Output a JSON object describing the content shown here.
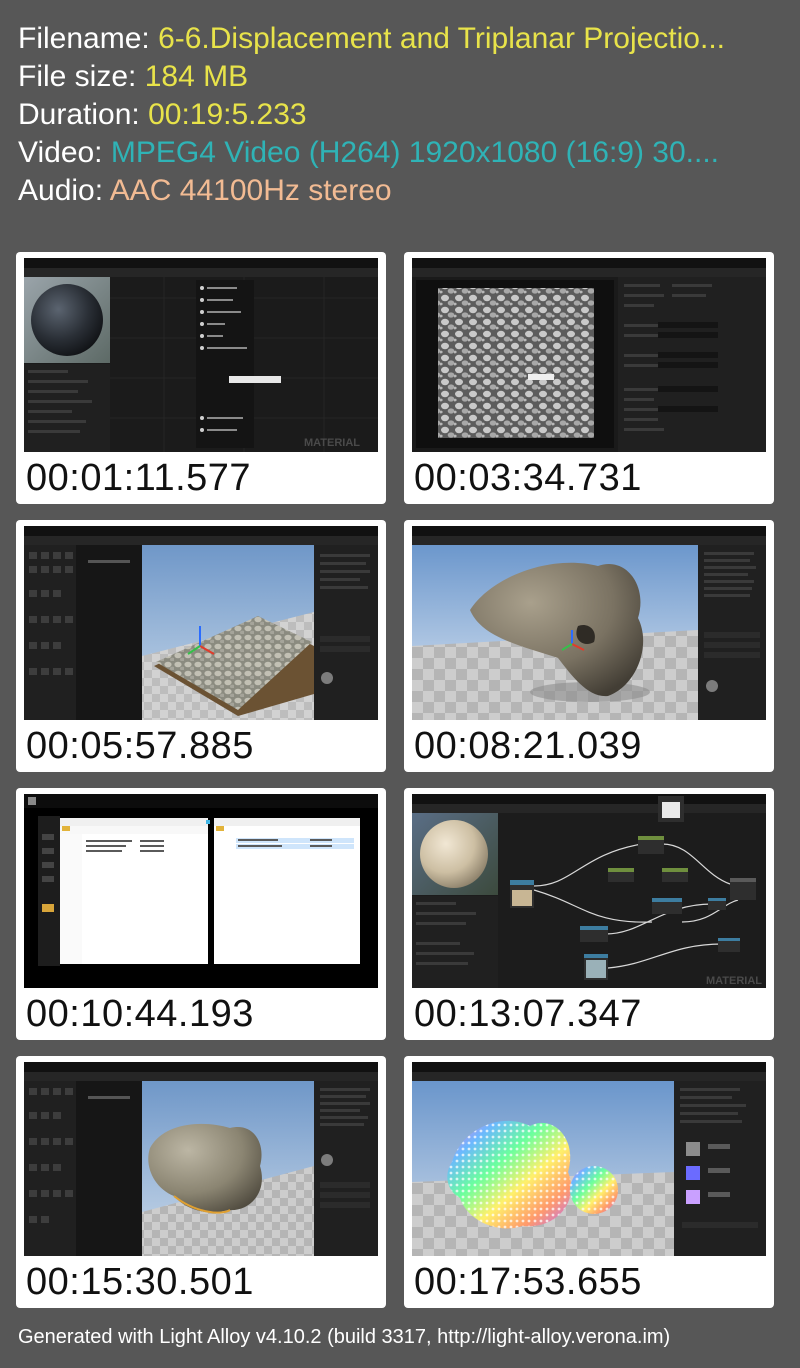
{
  "info": {
    "filename_label": "Filename: ",
    "filename_value": "6-6.Displacement and Triplanar Projectio...",
    "filesize_label": "File size: ",
    "filesize_value": "184 MB",
    "duration_label": "Duration: ",
    "duration_value": "00:19:5.233",
    "video_label": "Video: ",
    "video_value": "MPEG4 Video (H264) 1920x1080 (16:9) 30....",
    "audio_label": "Audio: ",
    "audio_value": "AAC 44100Hz stereo"
  },
  "thumbnails": [
    {
      "timestamp": "00:01:11.577",
      "scene": "material-editor-pins",
      "watermark": "MATERIAL"
    },
    {
      "timestamp": "00:03:34.731",
      "scene": "texture-viewer"
    },
    {
      "timestamp": "00:05:57.885",
      "scene": "modeling-plane"
    },
    {
      "timestamp": "00:08:21.039",
      "scene": "rock-viewport"
    },
    {
      "timestamp": "00:10:44.193",
      "scene": "file-explorer"
    },
    {
      "timestamp": "00:13:07.347",
      "scene": "material-graph",
      "watermark": "MATERIAL"
    },
    {
      "timestamp": "00:15:30.501",
      "scene": "rock-modeling"
    },
    {
      "timestamp": "00:17:53.655",
      "scene": "rainbow-rock"
    }
  ],
  "footer": {
    "text": "Generated with Light Alloy v4.10.2 (build 3317, http://light-alloy.verona.im)"
  },
  "colors": {
    "background": "#575757",
    "filename_value": "#e8e34a",
    "video_value": "#2fb3b6",
    "audio_value": "#f2bb93",
    "card": "#ffffff"
  }
}
